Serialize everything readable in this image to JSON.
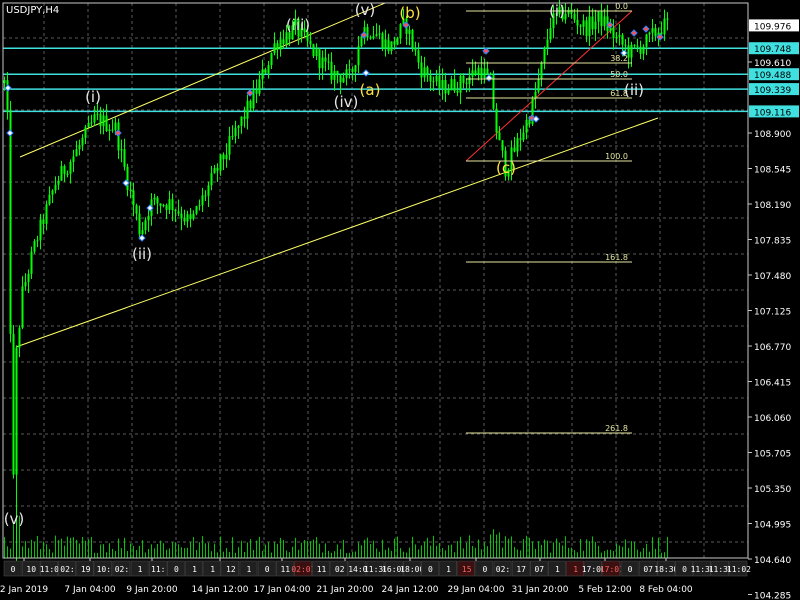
{
  "chart": {
    "symbol_label": "USDJPY,H4"
  },
  "colors": {
    "background": "#000000",
    "grid": "#5a5a5a",
    "frame": "#c8c8c8",
    "axis_text": "#ffffff",
    "candle": "#00ff00",
    "volume": "#00c800",
    "support": "#40e0e0",
    "channel": "#ffff66",
    "fib": "#e6e6a0",
    "fib_red": "#ff3030",
    "wave_white": "#e6e6e6",
    "wave_yellow": "#ffe040",
    "price_tag_bg": "#ffffff",
    "support_tag_bg": "#40e0e0"
  },
  "chart_data": {
    "type": "candlestick",
    "symbol": "USDJPY",
    "timeframe": "H4",
    "ylim": [
      104.1,
      110.2
    ],
    "y_ticks": [
      104.285,
      104.64,
      104.995,
      105.35,
      105.705,
      106.06,
      106.415,
      106.77,
      107.125,
      107.48,
      107.835,
      108.19,
      108.545,
      108.9,
      109.61
    ],
    "x_date_labels": [
      "2 Jan 2019",
      "7 Jan 04:00",
      "9 Jan 20:00",
      "14 Jan 12:00",
      "17 Jan 04:00",
      "21 Jan 20:00",
      "24 Jan 12:00",
      "29 Jan 04:00",
      "31 Jan 20:00",
      "5 Feb 12:00",
      "8 Feb 04:00"
    ],
    "current_price": 109.976,
    "support_levels": [
      109.748,
      109.488,
      109.339,
      109.116
    ],
    "fibonacci": {
      "levels": [
        {
          "label": "0.0",
          "price": 110.12
        },
        {
          "label": "38.2",
          "price": 109.6
        },
        {
          "label": "50.0",
          "price": 109.44
        },
        {
          "label": "61.8",
          "price": 109.25
        },
        {
          "label": "100.0",
          "price": 108.62
        },
        {
          "label": "161.8",
          "price": 107.61
        },
        {
          "label": "261.8",
          "price": 105.9
        }
      ]
    },
    "wave_labels": [
      {
        "text": "(v)",
        "color": "white",
        "price": 104.99
      },
      {
        "text": "(i)",
        "color": "white",
        "price": 109.21
      },
      {
        "text": "(ii)",
        "color": "white",
        "price": 107.64
      },
      {
        "text": "(iii)",
        "color": "white",
        "price": 109.93
      },
      {
        "text": "(iv)",
        "color": "white",
        "price": 109.16
      },
      {
        "text": "(v)",
        "color": "white",
        "price": 110.08
      },
      {
        "text": "(a)",
        "color": "yellow",
        "price": 109.28
      },
      {
        "text": "(b)",
        "color": "yellow",
        "price": 110.05
      },
      {
        "text": "(c)",
        "color": "yellow",
        "price": 108.5
      },
      {
        "text": "(i)",
        "color": "white",
        "price": 110.07
      },
      {
        "text": "(ii)",
        "color": "white",
        "price": 109.28
      }
    ],
    "time_strip_labels": [
      {
        "text": "0"
      },
      {
        "text": "10"
      },
      {
        "text": "11:0"
      },
      {
        "text": "02:"
      },
      {
        "text": "19"
      },
      {
        "text": "10:"
      },
      {
        "text": "02:"
      },
      {
        "text": "1"
      },
      {
        "text": "11:"
      },
      {
        "text": "0"
      },
      {
        "text": "1"
      },
      {
        "text": "1"
      },
      {
        "text": "12"
      },
      {
        "text": "1"
      },
      {
        "text": "0"
      },
      {
        "text": "11"
      },
      {
        "text": "02:01",
        "red": true
      },
      {
        "text": "11"
      },
      {
        "text": "02"
      },
      {
        "text": "14:0"
      },
      {
        "text": "11:30"
      },
      {
        "text": "16:00"
      },
      {
        "text": "18:00"
      },
      {
        "text": "0"
      },
      {
        "text": "1"
      },
      {
        "text": "15",
        "red": true
      },
      {
        "text": "0"
      },
      {
        "text": "02:"
      },
      {
        "text": "17"
      },
      {
        "text": "07"
      },
      {
        "text": "1"
      },
      {
        "text": "1",
        "red": true
      },
      {
        "text": "17:00"
      },
      {
        "text": "17:01",
        "red": true
      },
      {
        "text": "0"
      },
      {
        "text": "07"
      },
      {
        "text": "18:30"
      },
      {
        "text": "0"
      },
      {
        "text": "11:30"
      },
      {
        "text": "11:30"
      },
      {
        "text": "11:02"
      }
    ]
  }
}
